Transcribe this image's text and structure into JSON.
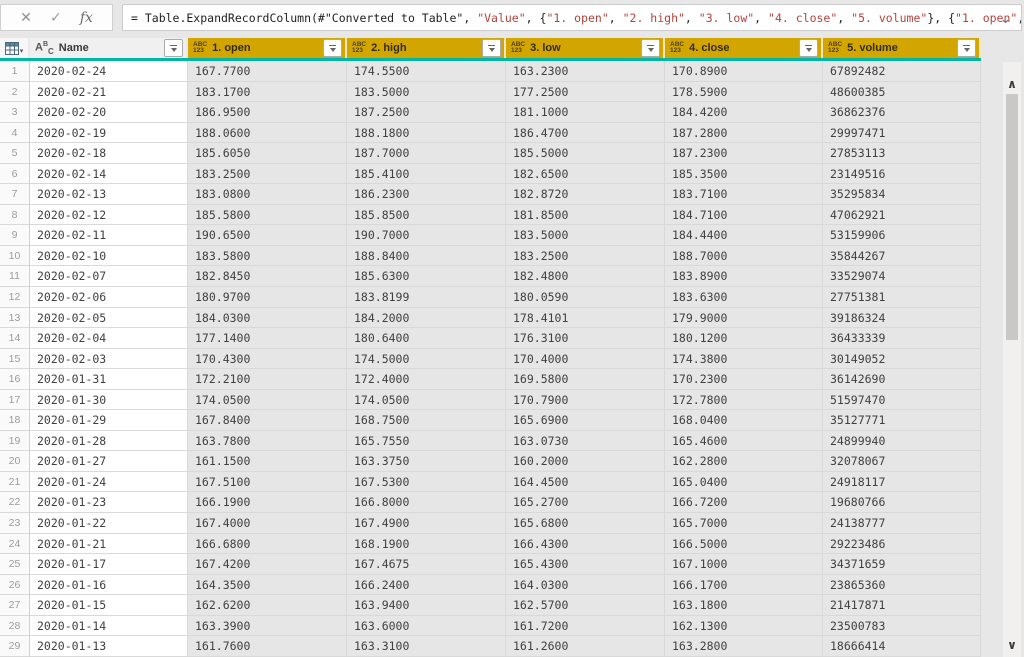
{
  "formula_bar": {
    "cancel_icon": "✕",
    "check_icon": "✓",
    "fx_label": "fx",
    "expand_icon": "⌄",
    "formula_segments": [
      {
        "kind": "code",
        "text": "= Table.ExpandRecordColumn(#\"Converted to Table\", "
      },
      {
        "kind": "string",
        "text": "\"Value\""
      },
      {
        "kind": "code",
        "text": ", {"
      },
      {
        "kind": "string",
        "text": "\"1. open\""
      },
      {
        "kind": "code",
        "text": ", "
      },
      {
        "kind": "string",
        "text": "\"2. high\""
      },
      {
        "kind": "code",
        "text": ", "
      },
      {
        "kind": "string",
        "text": "\"3. low\""
      },
      {
        "kind": "code",
        "text": ", "
      },
      {
        "kind": "string",
        "text": "\"4. close\""
      },
      {
        "kind": "code",
        "text": ", "
      },
      {
        "kind": "string",
        "text": "\"5. volume\""
      },
      {
        "kind": "code",
        "text": "}, {"
      },
      {
        "kind": "string",
        "text": "\"1. open\""
      },
      {
        "kind": "code",
        "text": ","
      }
    ]
  },
  "grid": {
    "columns": [
      {
        "label": "Name",
        "type_icon": "text-abc",
        "selected": false
      },
      {
        "label": "1. open",
        "type_icon": "any-abc123",
        "selected": true
      },
      {
        "label": "2. high",
        "type_icon": "any-abc123",
        "selected": true
      },
      {
        "label": "3. low",
        "type_icon": "any-abc123",
        "selected": true
      },
      {
        "label": "4. close",
        "type_icon": "any-abc123",
        "selected": true
      },
      {
        "label": "5. volume",
        "type_icon": "any-abc123",
        "selected": true
      }
    ],
    "rows": [
      {
        "n": "1",
        "name": "2020-02-24",
        "open": "167.7700",
        "high": "174.5500",
        "low": "163.2300",
        "close": "170.8900",
        "volume": "67892482"
      },
      {
        "n": "2",
        "name": "2020-02-21",
        "open": "183.1700",
        "high": "183.5000",
        "low": "177.2500",
        "close": "178.5900",
        "volume": "48600385"
      },
      {
        "n": "3",
        "name": "2020-02-20",
        "open": "186.9500",
        "high": "187.2500",
        "low": "181.1000",
        "close": "184.4200",
        "volume": "36862376"
      },
      {
        "n": "4",
        "name": "2020-02-19",
        "open": "188.0600",
        "high": "188.1800",
        "low": "186.4700",
        "close": "187.2800",
        "volume": "29997471"
      },
      {
        "n": "5",
        "name": "2020-02-18",
        "open": "185.6050",
        "high": "187.7000",
        "low": "185.5000",
        "close": "187.2300",
        "volume": "27853113"
      },
      {
        "n": "6",
        "name": "2020-02-14",
        "open": "183.2500",
        "high": "185.4100",
        "low": "182.6500",
        "close": "185.3500",
        "volume": "23149516"
      },
      {
        "n": "7",
        "name": "2020-02-13",
        "open": "183.0800",
        "high": "186.2300",
        "low": "182.8720",
        "close": "183.7100",
        "volume": "35295834"
      },
      {
        "n": "8",
        "name": "2020-02-12",
        "open": "185.5800",
        "high": "185.8500",
        "low": "181.8500",
        "close": "184.7100",
        "volume": "47062921"
      },
      {
        "n": "9",
        "name": "2020-02-11",
        "open": "190.6500",
        "high": "190.7000",
        "low": "183.5000",
        "close": "184.4400",
        "volume": "53159906"
      },
      {
        "n": "10",
        "name": "2020-02-10",
        "open": "183.5800",
        "high": "188.8400",
        "low": "183.2500",
        "close": "188.7000",
        "volume": "35844267"
      },
      {
        "n": "11",
        "name": "2020-02-07",
        "open": "182.8450",
        "high": "185.6300",
        "low": "182.4800",
        "close": "183.8900",
        "volume": "33529074"
      },
      {
        "n": "12",
        "name": "2020-02-06",
        "open": "180.9700",
        "high": "183.8199",
        "low": "180.0590",
        "close": "183.6300",
        "volume": "27751381"
      },
      {
        "n": "13",
        "name": "2020-02-05",
        "open": "184.0300",
        "high": "184.2000",
        "low": "178.4101",
        "close": "179.9000",
        "volume": "39186324"
      },
      {
        "n": "14",
        "name": "2020-02-04",
        "open": "177.1400",
        "high": "180.6400",
        "low": "176.3100",
        "close": "180.1200",
        "volume": "36433339"
      },
      {
        "n": "15",
        "name": "2020-02-03",
        "open": "170.4300",
        "high": "174.5000",
        "low": "170.4000",
        "close": "174.3800",
        "volume": "30149052"
      },
      {
        "n": "16",
        "name": "2020-01-31",
        "open": "172.2100",
        "high": "172.4000",
        "low": "169.5800",
        "close": "170.2300",
        "volume": "36142690"
      },
      {
        "n": "17",
        "name": "2020-01-30",
        "open": "174.0500",
        "high": "174.0500",
        "low": "170.7900",
        "close": "172.7800",
        "volume": "51597470"
      },
      {
        "n": "18",
        "name": "2020-01-29",
        "open": "167.8400",
        "high": "168.7500",
        "low": "165.6900",
        "close": "168.0400",
        "volume": "35127771"
      },
      {
        "n": "19",
        "name": "2020-01-28",
        "open": "163.7800",
        "high": "165.7550",
        "low": "163.0730",
        "close": "165.4600",
        "volume": "24899940"
      },
      {
        "n": "20",
        "name": "2020-01-27",
        "open": "161.1500",
        "high": "163.3750",
        "low": "160.2000",
        "close": "162.2800",
        "volume": "32078067"
      },
      {
        "n": "21",
        "name": "2020-01-24",
        "open": "167.5100",
        "high": "167.5300",
        "low": "164.4500",
        "close": "165.0400",
        "volume": "24918117"
      },
      {
        "n": "22",
        "name": "2020-01-23",
        "open": "166.1900",
        "high": "166.8000",
        "low": "165.2700",
        "close": "166.7200",
        "volume": "19680766"
      },
      {
        "n": "23",
        "name": "2020-01-22",
        "open": "167.4000",
        "high": "167.4900",
        "low": "165.6800",
        "close": "165.7000",
        "volume": "24138777"
      },
      {
        "n": "24",
        "name": "2020-01-21",
        "open": "166.6800",
        "high": "168.1900",
        "low": "166.4300",
        "close": "166.5000",
        "volume": "29223486"
      },
      {
        "n": "25",
        "name": "2020-01-17",
        "open": "167.4200",
        "high": "167.4675",
        "low": "165.4300",
        "close": "167.1000",
        "volume": "34371659"
      },
      {
        "n": "26",
        "name": "2020-01-16",
        "open": "164.3500",
        "high": "166.2400",
        "low": "164.0300",
        "close": "166.1700",
        "volume": "23865360"
      },
      {
        "n": "27",
        "name": "2020-01-15",
        "open": "162.6200",
        "high": "163.9400",
        "low": "162.5700",
        "close": "163.1800",
        "volume": "21417871"
      },
      {
        "n": "28",
        "name": "2020-01-14",
        "open": "163.3900",
        "high": "163.6000",
        "low": "161.7200",
        "close": "162.1300",
        "volume": "23500783"
      },
      {
        "n": "29",
        "name": "2020-01-13",
        "open": "161.7600",
        "high": "163.3100",
        "low": "161.2600",
        "close": "163.2800",
        "volume": "18666414"
      }
    ]
  },
  "scrollbar": {
    "up_icon": "∧",
    "down_icon": "∨"
  },
  "colors": {
    "selected_header_bg": "#d2a500",
    "selection_accent": "#00b7a3",
    "string_color": "#b5433b"
  }
}
